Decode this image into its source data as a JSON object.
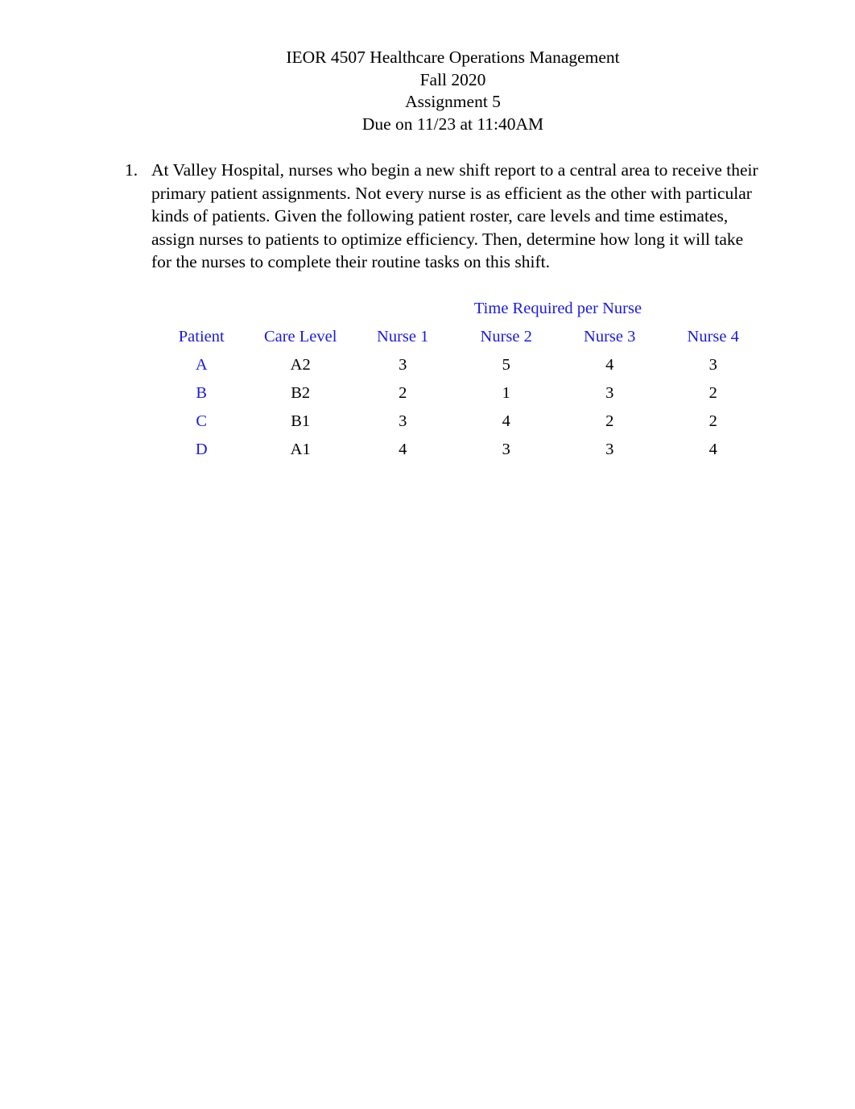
{
  "document": {
    "header_lines": [
      "IEOR 4507 Healthcare Operations Management",
      "Fall 2020",
      "Assignment 5",
      "Due on 11/23 at 11:40AM"
    ],
    "questions": [
      {
        "marker": "1.",
        "text": "At Valley Hospital, nurses who begin a new shift report to a central area to receive their primary patient assignments. Not every nurse is as efficient as the other with particular kinds of patients. Given the following patient roster, care levels and time estimates, assign nurses to patients to optimize efficiency. Then, determine how long it will take for the nurses to complete their routine tasks on this shift."
      }
    ]
  },
  "colors": {
    "heading_blue": "#1a1ae0",
    "body_black": "#000000",
    "page_background": "#ffffff"
  },
  "chart_data": {
    "type": "table",
    "title": "Time Required per Nurse",
    "group_header": "Time Required per Nurse",
    "group_header_span_columns": [
      "Nurse 1",
      "Nurse 2",
      "Nurse 3",
      "Nurse 4"
    ],
    "columns": [
      "Patient",
      "Care Level",
      "Nurse 1",
      "Nurse 2",
      "Nurse 3",
      "Nurse 4"
    ],
    "rows": [
      {
        "patient": "A",
        "care_level": "A2",
        "nurse1": 3,
        "nurse2": 5,
        "nurse3": 4,
        "nurse4": 3
      },
      {
        "patient": "B",
        "care_level": "B2",
        "nurse1": 2,
        "nurse2": 1,
        "nurse3": 3,
        "nurse4": 2
      },
      {
        "patient": "C",
        "care_level": "B1",
        "nurse1": 3,
        "nurse2": 4,
        "nurse3": 2,
        "nurse4": 2
      },
      {
        "patient": "D",
        "care_level": "A1",
        "nurse1": 4,
        "nurse2": 3,
        "nurse3": 3,
        "nurse4": 4
      }
    ],
    "cells": [
      [
        "A",
        "A2",
        "3",
        "5",
        "4",
        "3"
      ],
      [
        "B",
        "B2",
        "2",
        "1",
        "3",
        "2"
      ],
      [
        "C",
        "B1",
        "3",
        "4",
        "2",
        "2"
      ],
      [
        "D",
        "A1",
        "4",
        "3",
        "3",
        "4"
      ]
    ],
    "xlabel": "",
    "ylabel": "",
    "grid": false,
    "legend": "none"
  }
}
